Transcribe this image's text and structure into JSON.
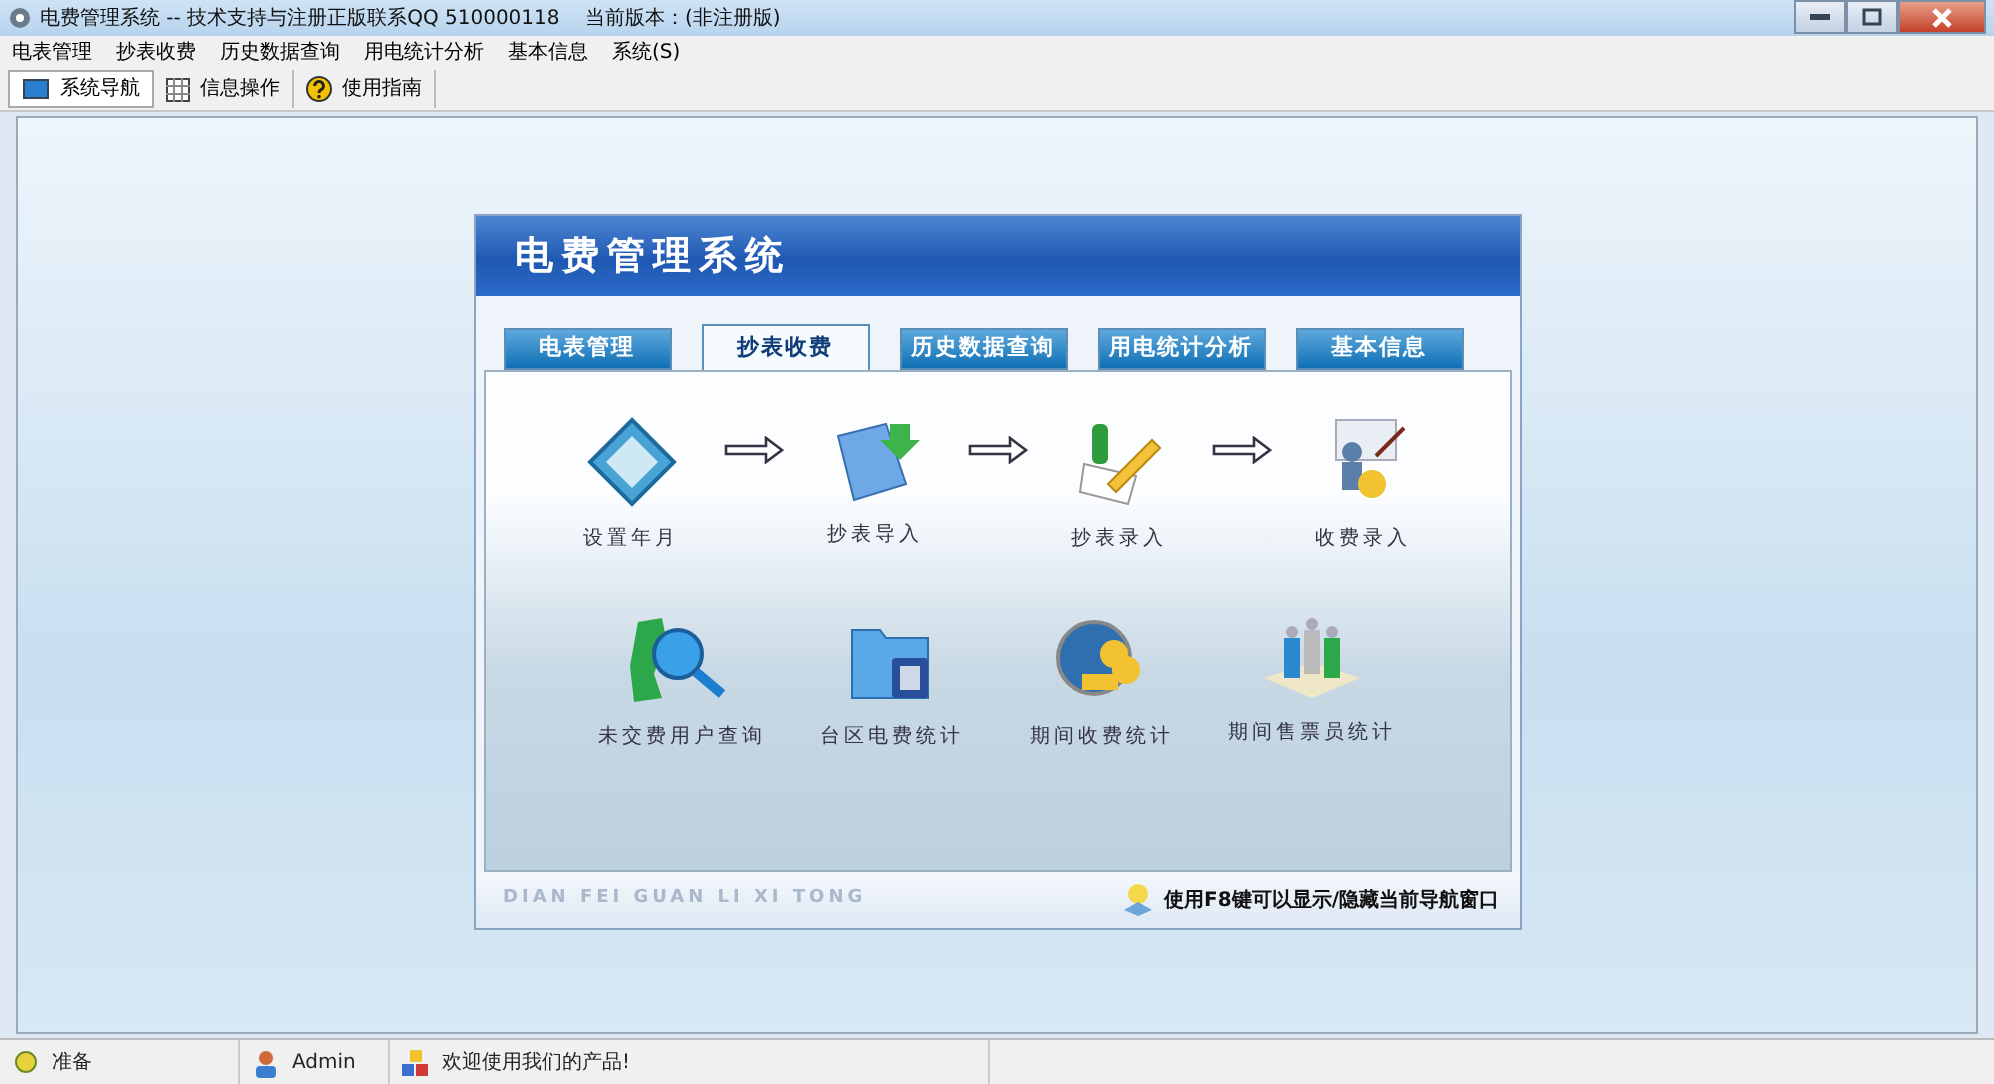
{
  "window": {
    "title": "电费管理系统 -- 技术支持与注册正版联系QQ 510000118    当前版本：(非注册版)"
  },
  "menu": [
    "电表管理",
    "抄表收费",
    "历史数据查询",
    "用电统计分析",
    "基本信息",
    "系统(S)"
  ],
  "toolbar": [
    {
      "label": "系统导航",
      "selected": true
    },
    {
      "label": "信息操作",
      "selected": false
    },
    {
      "label": "使用指南",
      "selected": false
    }
  ],
  "panel": {
    "title": "电费管理系统",
    "tabs": [
      {
        "label": "电表管理",
        "selected": false
      },
      {
        "label": "抄表收费",
        "selected": true
      },
      {
        "label": "历史数据查询",
        "selected": false
      },
      {
        "label": "用电统计分析",
        "selected": false
      },
      {
        "label": "基本信息",
        "selected": false
      }
    ],
    "rows": [
      {
        "kind": "flow",
        "items": [
          "设置年月",
          "抄表导入",
          "抄表录入",
          "收费录入"
        ]
      },
      {
        "kind": "grid",
        "items": [
          "未交费用户查询",
          "台区电费统计",
          "期间收费统计",
          "期间售票员统计"
        ]
      }
    ],
    "footer_brand": "DIAN FEI GUAN LI XI TONG",
    "footer_hint": "使用F8键可以显示/隐藏当前导航窗口"
  },
  "status_bar": [
    "准备",
    "Admin",
    "欢迎使用我们的产品!"
  ]
}
